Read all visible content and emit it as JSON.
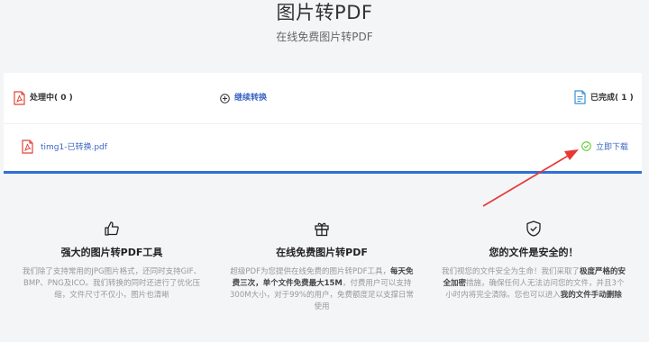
{
  "header": {
    "title": "图片转PDF",
    "subtitle": "在线免费图片转PDF"
  },
  "status_bar": {
    "processing_label": "处理中( 0 )",
    "continue_label": "继续转换",
    "done_label": "已完成( 1 )"
  },
  "file": {
    "name": "timg1-已转换.pdf",
    "download_label": "立即下载"
  },
  "features": [
    {
      "icon": "thumbs-up-icon",
      "title": "强大的图片转PDF工具",
      "desc": "我们除了支持常用的JPG图片格式，还同时支持GIF、BMP、PNG及ICO。我们转换的同时还进行了优化压缩，文件尺寸不仅小，图片也清晰"
    },
    {
      "icon": "gift-icon",
      "title": "在线免费图片转PDF",
      "desc_pre": "超级PDF为您提供在线免费的图片转PDF工具，",
      "desc_bold": "每天免费三次，单个文件免费最大15M",
      "desc_post": "，付费用户可以支持300M大小，对于99%的用户，免费额度足以支撑日常使用"
    },
    {
      "icon": "shield-check-icon",
      "title": "您的文件是安全的！",
      "desc_pre": "我们视您的文件安全为生命！我们采取了",
      "desc_bold": "极度严格的安全加密",
      "desc_mid": "措施，确保任何人无法访问您的文件，并且3个小时内将完全清除。您也可以进入",
      "desc_bold2": "我的文件手动删除"
    }
  ],
  "colors": {
    "accent": "#2f6fd6",
    "link": "#3a66c2",
    "success": "#52c41a",
    "arrow": "#e53935",
    "pdf_red": "#e0463a"
  }
}
